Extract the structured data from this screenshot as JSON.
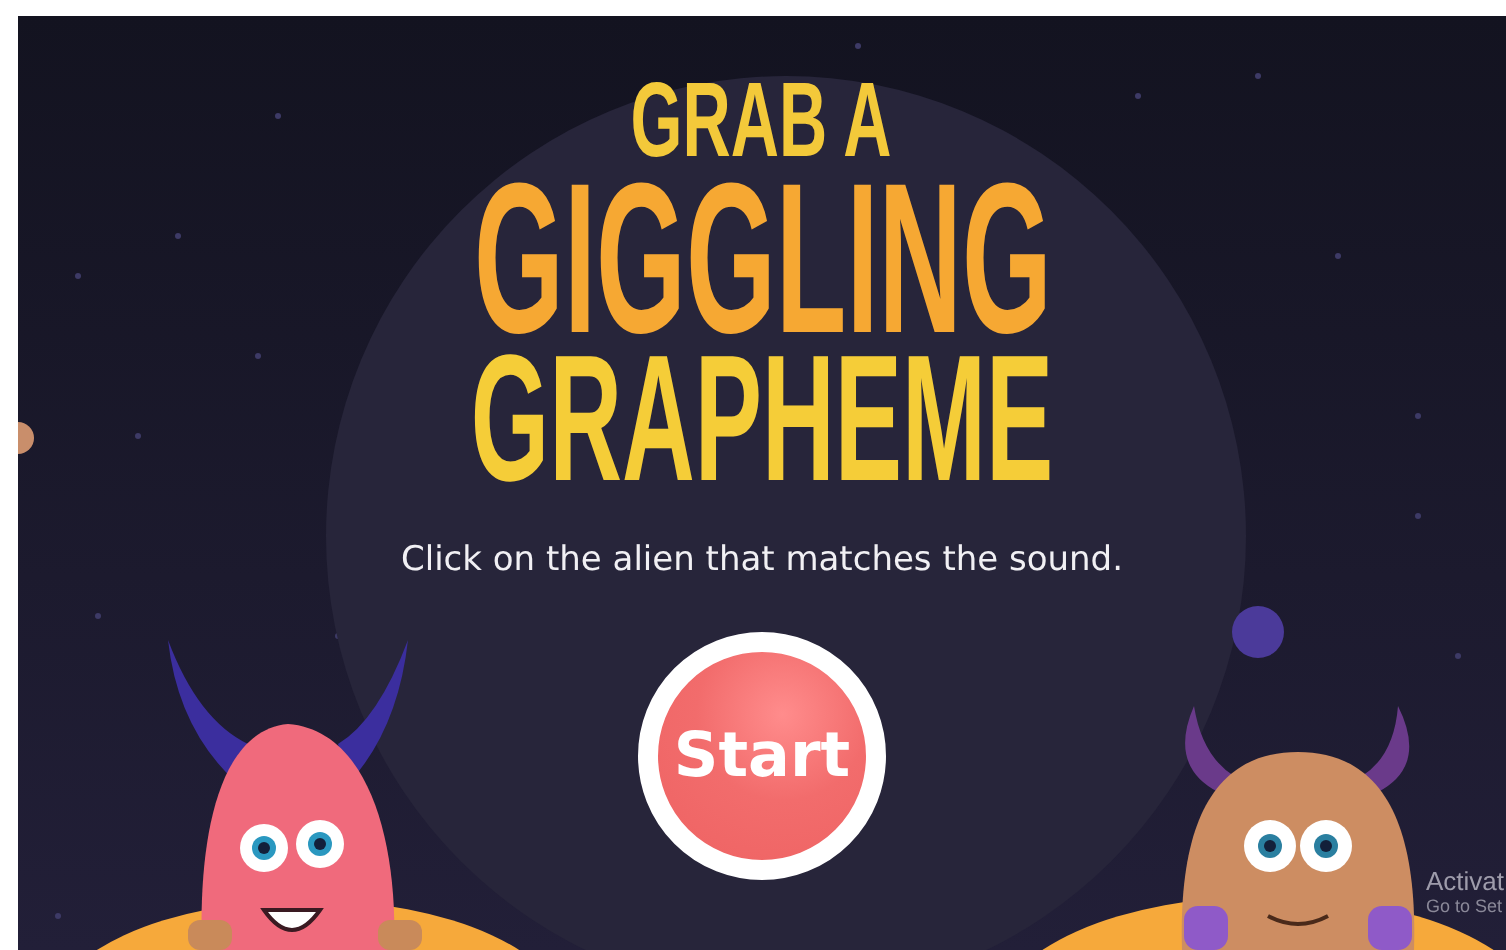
{
  "title": {
    "lines": [
      "GRAB A",
      "GIGGLING",
      "GRAPHEME"
    ]
  },
  "instruction": "Click on the alien that matches the sound.",
  "start_button": {
    "label": "Start"
  },
  "activation_notice": {
    "heading": "Activat",
    "detail": "Go to Set"
  }
}
